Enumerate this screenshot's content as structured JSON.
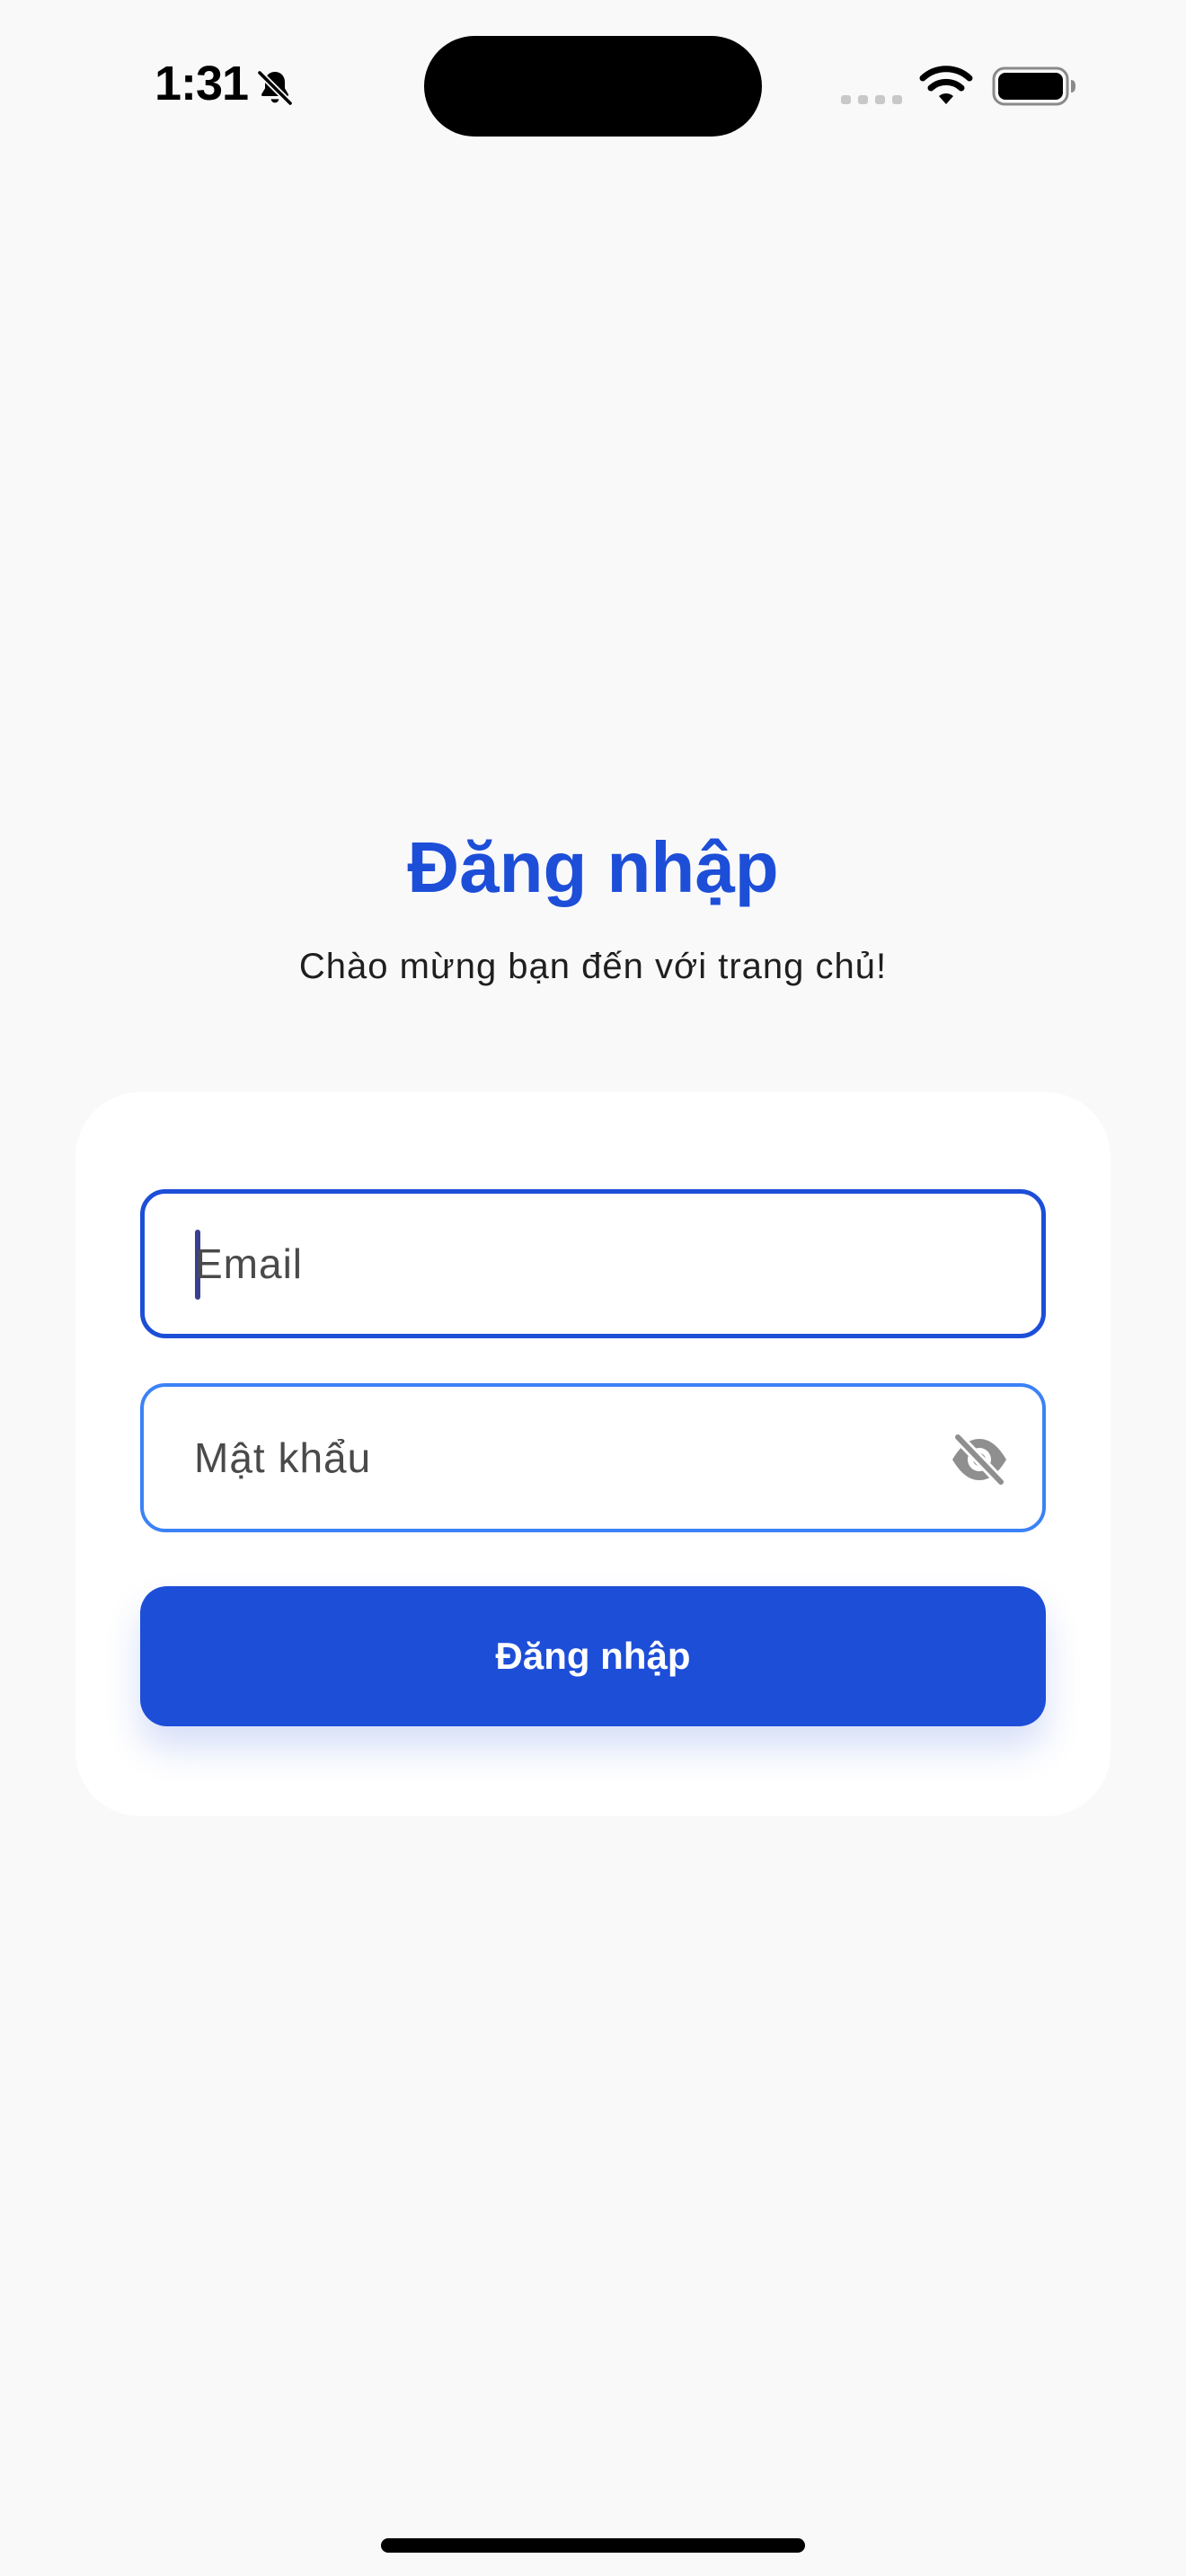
{
  "status_bar": {
    "time": "1:31",
    "icons": [
      "bell-slash-icon",
      "cellular-signal-icon",
      "wifi-icon",
      "battery-icon"
    ]
  },
  "header": {
    "title": "Đăng nhập",
    "subtitle": "Chào mừng bạn đến với trang chủ!"
  },
  "form": {
    "email_placeholder": "Email",
    "password_placeholder": "Mật khẩu",
    "password_toggle_icon": "eye-slash-icon",
    "submit_label": "Đăng nhập"
  },
  "colors": {
    "accent": "#1d4ed8",
    "background": "#f9f9fa",
    "card": "#ffffff"
  }
}
